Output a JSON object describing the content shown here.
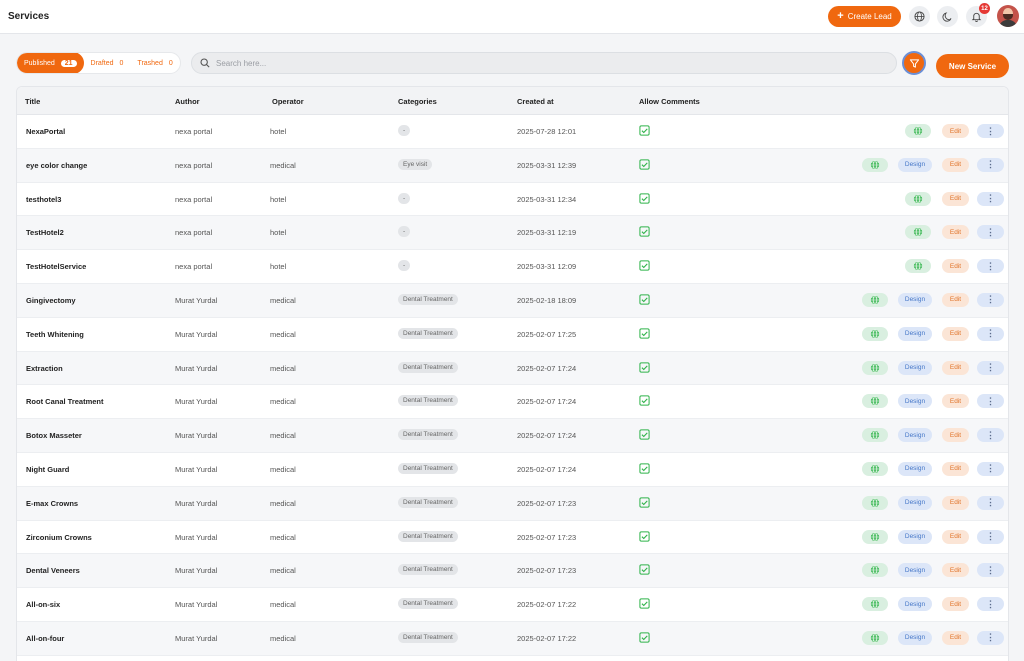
{
  "header": {
    "title": "Services",
    "create_lead_label": "Create Lead",
    "notifications_count": "12"
  },
  "toolbar": {
    "tabs": [
      {
        "label": "Published",
        "count": "21"
      },
      {
        "label": "Drafted",
        "count": "0"
      },
      {
        "label": "Trashed",
        "count": "0"
      }
    ],
    "search_placeholder": "Search here...",
    "new_service_label": "New Service"
  },
  "table": {
    "columns": [
      "Title",
      "Author",
      "Operator",
      "Categories",
      "Created at",
      "Allow Comments"
    ],
    "design_label": "Design",
    "edit_label": "Edit",
    "rows": [
      {
        "title": "NexaPortal",
        "author": "nexa portal",
        "operator": "hotel",
        "category": "-",
        "created": "2025-07-28 12:01",
        "design": false
      },
      {
        "title": "eye color change",
        "author": "nexa portal",
        "operator": "medical",
        "category": "Eye visit",
        "created": "2025-03-31 12:39",
        "design": true
      },
      {
        "title": "testhotel3",
        "author": "nexa portal",
        "operator": "hotel",
        "category": "-",
        "created": "2025-03-31 12:34",
        "design": false
      },
      {
        "title": "TestHotel2",
        "author": "nexa portal",
        "operator": "hotel",
        "category": "-",
        "created": "2025-03-31 12:19",
        "design": false
      },
      {
        "title": "TestHotelService",
        "author": "nexa portal",
        "operator": "hotel",
        "category": "-",
        "created": "2025-03-31 12:09",
        "design": false
      },
      {
        "title": "Gingivectomy",
        "author": "Murat Yurdal",
        "operator": "medical",
        "category": "Dental Treatment",
        "created": "2025-02-18 18:09",
        "design": true
      },
      {
        "title": "Teeth Whitening",
        "author": "Murat Yurdal",
        "operator": "medical",
        "category": "Dental Treatment",
        "created": "2025-02-07 17:25",
        "design": true
      },
      {
        "title": "Extraction",
        "author": "Murat Yurdal",
        "operator": "medical",
        "category": "Dental Treatment",
        "created": "2025-02-07 17:24",
        "design": true
      },
      {
        "title": "Root Canal Treatment",
        "author": "Murat Yurdal",
        "operator": "medical",
        "category": "Dental Treatment",
        "created": "2025-02-07 17:24",
        "design": true
      },
      {
        "title": "Botox Masseter",
        "author": "Murat Yurdal",
        "operator": "medical",
        "category": "Dental Treatment",
        "created": "2025-02-07 17:24",
        "design": true
      },
      {
        "title": "Night Guard",
        "author": "Murat Yurdal",
        "operator": "medical",
        "category": "Dental Treatment",
        "created": "2025-02-07 17:24",
        "design": true
      },
      {
        "title": "E-max Crowns",
        "author": "Murat Yurdal",
        "operator": "medical",
        "category": "Dental Treatment",
        "created": "2025-02-07 17:23",
        "design": true
      },
      {
        "title": "Zirconium Crowns",
        "author": "Murat Yurdal",
        "operator": "medical",
        "category": "Dental Treatment",
        "created": "2025-02-07 17:23",
        "design": true
      },
      {
        "title": "Dental Veneers",
        "author": "Murat Yurdal",
        "operator": "medical",
        "category": "Dental Treatment",
        "created": "2025-02-07 17:23",
        "design": true
      },
      {
        "title": "All-on-six",
        "author": "Murat Yurdal",
        "operator": "medical",
        "category": "Dental Treatment",
        "created": "2025-02-07 17:22",
        "design": true
      },
      {
        "title": "All-on-four",
        "author": "Murat Yurdal",
        "operator": "medical",
        "category": "Dental Treatment",
        "created": "2025-02-07 17:22",
        "design": true
      }
    ]
  },
  "colors": {
    "accent": "#f0680f",
    "check": "#2fb34a"
  },
  "icons": {
    "search": "search-icon",
    "filter": "filter-icon",
    "globe": "globe-icon",
    "moon": "moon-icon",
    "bell": "bell-icon",
    "check": "checkbox-checked-icon",
    "more": "more-vertical-icon"
  }
}
